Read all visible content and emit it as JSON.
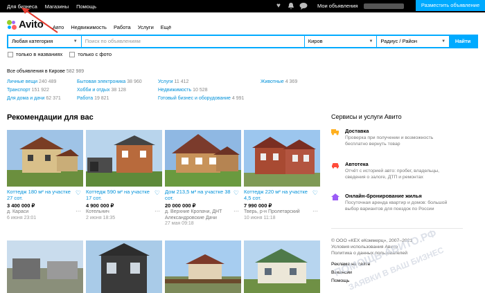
{
  "topbar": {
    "links": [
      "Для бизнеса",
      "Магазины",
      "Помощь"
    ],
    "my_ads": "Мои объявления",
    "post_button": "Разместить объявление"
  },
  "header": {
    "logo": "Avito",
    "nav": [
      "Авто",
      "Недвижимость",
      "Работа",
      "Услуги",
      "Ещё"
    ]
  },
  "search": {
    "category": "Любая категория",
    "placeholder": "Поиск по объявлениям",
    "city": "Киров",
    "radius": "Радиус / Район",
    "find_button": "Найти",
    "check_titles": "только в названиях",
    "check_photo": "только с фото"
  },
  "all_ads": {
    "label": "Все объявления в Кирове",
    "count": "582 989"
  },
  "categories": [
    {
      "label": "Личные вещи",
      "count": "240 489"
    },
    {
      "label": "Транспорт",
      "count": "151 922"
    },
    {
      "label": "Для дома и дачи",
      "count": "62 371"
    },
    {
      "label": "Бытовая электроника",
      "count": "38 960"
    },
    {
      "label": "Хобби и отдых",
      "count": "38 128"
    },
    {
      "label": "Работа",
      "count": "19 821"
    },
    {
      "label": "Услуги",
      "count": "11 412"
    },
    {
      "label": "Недвижимость",
      "count": "10 528"
    },
    {
      "label": "Готовый бизнес и оборудование",
      "count": "4 991"
    },
    {
      "label": "Животные",
      "count": "4 369"
    }
  ],
  "recommendations": {
    "title": "Рекомендации для вас",
    "cards": [
      {
        "title": "Коттедж 180 м² на участке 27 сот.",
        "price": "3 400 000 ₽",
        "addr": "д. Караси",
        "date": "6 июня 23:01"
      },
      {
        "title": "Коттедж 590 м² на участке 17 сот.",
        "price": "4 900 000 ₽",
        "addr": "Котельнич",
        "date": "2 июня 18:35"
      },
      {
        "title": "Дом 213,5 м² на участке 38 сот.",
        "price": "20 000 000 ₽",
        "addr": "д. Верхние Кропачи, ДНТ Александровские Дачи",
        "date": "27 мая 09:18"
      },
      {
        "title": "Коттедж 220 м² на участке 4,5 сот.",
        "price": "7 990 000 ₽",
        "addr": "Тверь, р-н Пролетарский",
        "date": "10 июня 11:18"
      }
    ]
  },
  "sidebar": {
    "title": "Сервисы и услуги Авито",
    "services": [
      {
        "name": "Доставка",
        "desc": "Проверка при получении и возможность бесплатно вернуть товар",
        "icon": "truck-icon",
        "color": "#ffb020"
      },
      {
        "name": "Автотека",
        "desc": "Отчёт с историей авто: пробег, владельцы, сведения о залоге, ДТП и ремонтах",
        "icon": "car-report-icon",
        "color": "#ff4c3b"
      },
      {
        "name": "Онлайн-бронирование жилья",
        "desc": "Посуточная аренда квартир и домов: большой выбор вариантов для поездок по России",
        "icon": "house-icon",
        "color": "#9b5cf6"
      }
    ],
    "copyright": "© ООО «КЕХ еКоммерц», 2007–2021",
    "terms": "Условия использования Авито",
    "privacy": "Политика о данных пользователей",
    "ads_link": "Реклама на сайте",
    "jobs": "Вакансии",
    "help": "Помощь"
  },
  "watermark": {
    "line1": "ЗАЯВКИ В ВАШ БИЗНЕС",
    "line2": "ПОМОЩЬ-АВИТО.РФ"
  },
  "colors": {
    "accent": "#00aaff",
    "link": "#0091d9",
    "topbar": "#000000"
  }
}
